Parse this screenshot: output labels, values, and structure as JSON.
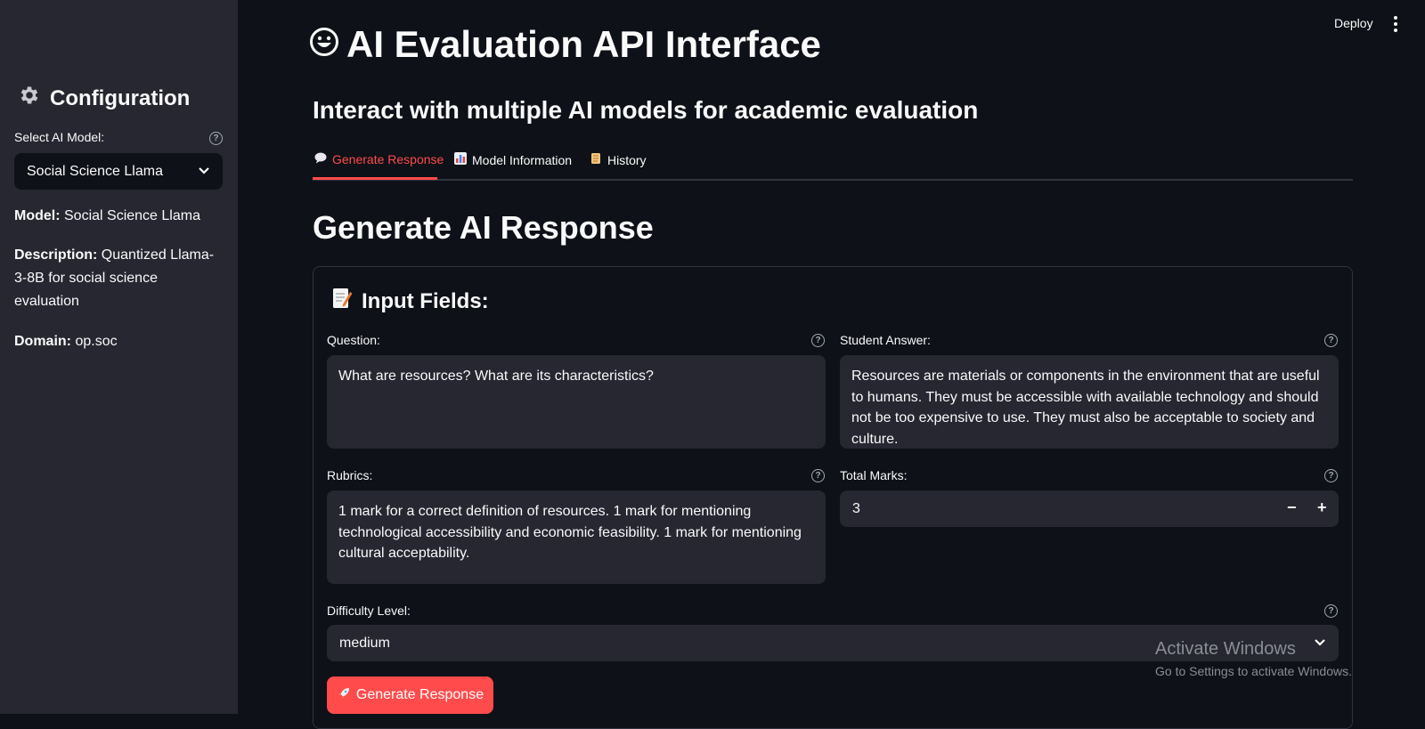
{
  "sidebar": {
    "title": "Configuration",
    "select_label": "Select AI Model:",
    "selected_model": "Social Science Llama",
    "model_key": "Model:",
    "model_value": "Social Science Llama",
    "description_key": "Description:",
    "description_value": "Quantized Llama-3-8B for social science evaluation",
    "domain_key": "Domain:",
    "domain_value": "op.soc"
  },
  "header": {
    "title": "AI Evaluation API Interface",
    "subtitle": "Interact with multiple AI models for academic evaluation",
    "deploy_label": "Deploy"
  },
  "tabs": [
    {
      "label": "Generate Response",
      "icon": "speech-balloon-icon",
      "active": true
    },
    {
      "label": "Model Information",
      "icon": "bar-chart-icon",
      "active": false
    },
    {
      "label": "History",
      "icon": "scroll-icon",
      "active": false
    }
  ],
  "main": {
    "section_title": "Generate AI Response",
    "card_title": "Input Fields:",
    "question_label": "Question:",
    "question_value": "What are resources? What are its characteristics?",
    "student_answer_label": "Student Answer:",
    "student_answer_value": "Resources are materials or components in the environment that are useful to humans. They must be accessible with available technology and should not be too expensive to use. They must also be acceptable to society and culture.",
    "rubrics_label": "Rubrics:",
    "rubrics_value": "1 mark for a correct definition of resources. 1 mark for mentioning technological accessibility and economic feasibility. 1 mark for mentioning cultural acceptability.",
    "total_marks_label": "Total Marks:",
    "total_marks_value": "3",
    "minus": "−",
    "plus": "+",
    "difficulty_label": "Difficulty Level:",
    "difficulty_value": "medium",
    "generate_button": "Generate Response"
  },
  "watermark": {
    "title": "Activate Windows",
    "subtitle": "Go to Settings to activate Windows."
  },
  "colors": {
    "accent": "#ff4b4b",
    "background": "#0e1117",
    "sidebar": "#262730",
    "input": "#262730"
  }
}
